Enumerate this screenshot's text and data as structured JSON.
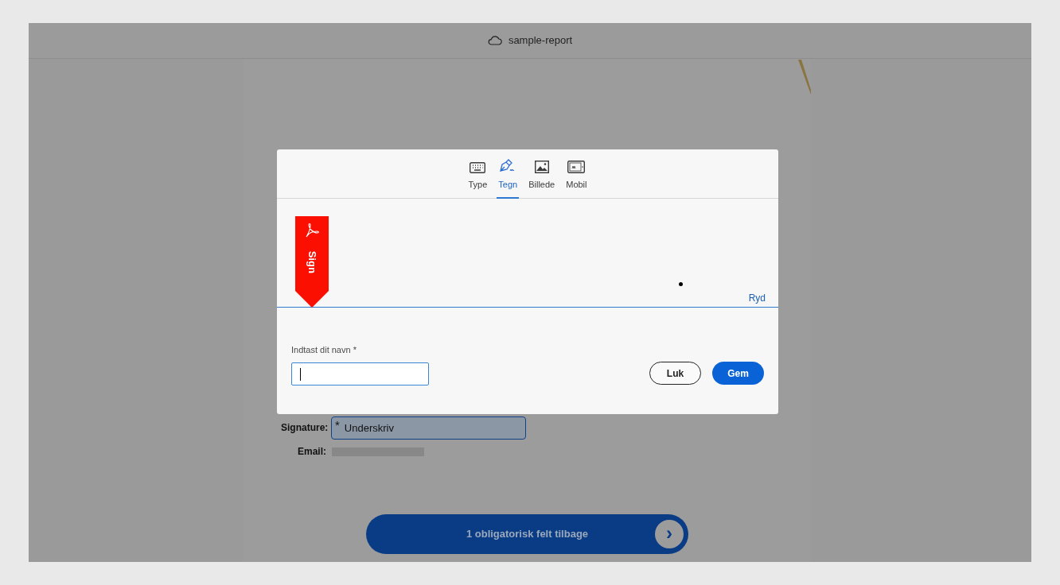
{
  "top_bar": {
    "title": "sample-report"
  },
  "document": {
    "fields": [
      {
        "kind": "signature",
        "label": "Signature:",
        "required_mark": "*",
        "value": "Underskriv"
      },
      {
        "kind": "redacted",
        "label": "Email:"
      }
    ],
    "progress_button": {
      "label": "1 obligatorisk felt tilbage",
      "arrow": "›"
    }
  },
  "dialog": {
    "tabs": [
      {
        "kind": "keyboard",
        "label": "Type",
        "selected": false
      },
      {
        "kind": "pen",
        "label": "Tegn",
        "selected": true
      },
      {
        "kind": "image",
        "label": "Billede",
        "selected": false
      },
      {
        "kind": "mobile",
        "label": "Mobil",
        "selected": false
      }
    ],
    "sign_ribbon": "Sign",
    "clear_link": "Ryd",
    "name_field": {
      "label": "Indtast dit navn",
      "required_mark": "*"
    },
    "buttons": [
      {
        "kind": "secondary",
        "label": "Luk"
      },
      {
        "kind": "primary",
        "label": "Gem"
      }
    ]
  }
}
